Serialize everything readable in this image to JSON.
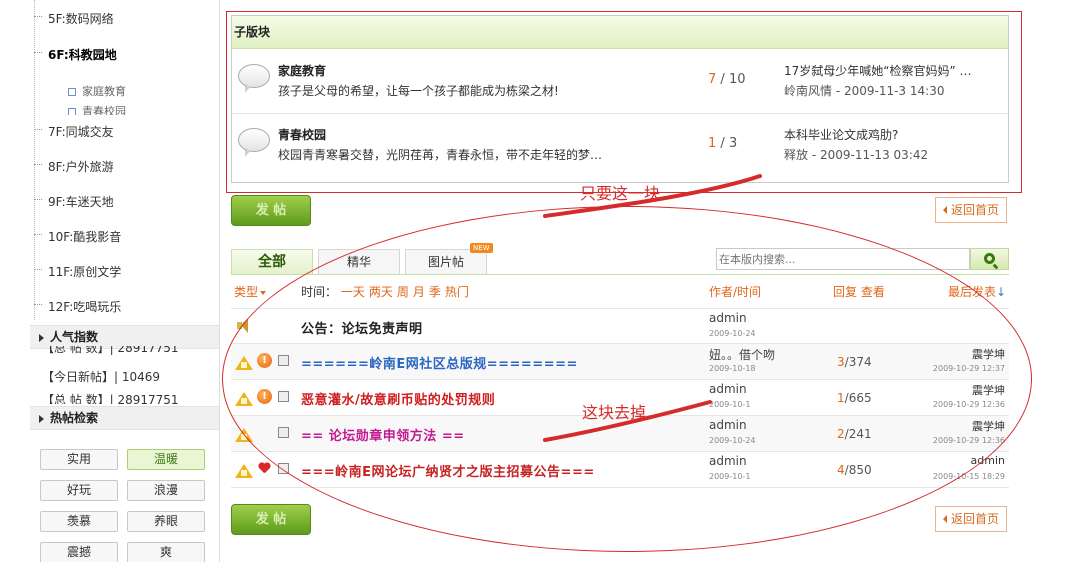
{
  "sidebar": {
    "forums": [
      {
        "label": "5F:数码网络"
      },
      {
        "label": "6F:科教园地"
      },
      {
        "label": "7F:同城交友"
      },
      {
        "label": "8F:户外旅游"
      },
      {
        "label": "9F:车迷天地"
      },
      {
        "label": "10F:酷我影音"
      },
      {
        "label": "11F:原创文学"
      },
      {
        "label": "12F:吃喝玩乐"
      }
    ],
    "subforums": [
      {
        "label": "家庭教育"
      },
      {
        "label": "青春校园"
      }
    ],
    "popularity": {
      "title": "人气指数",
      "rows": [
        {
          "label": "【总 帖 数】| 28917751"
        },
        {
          "label": "【今日新帖】| 10469"
        },
        {
          "label": "【总 帖 数】| 28917751"
        }
      ]
    },
    "hot_search": {
      "title": "热帖检索",
      "tags": [
        "实用",
        "温暖",
        "好玩",
        "浪漫",
        "羡慕",
        "养眼",
        "震撼",
        "爽"
      ],
      "active_tag": "温暖"
    }
  },
  "subforum_box": {
    "title": "子版块",
    "rows": [
      {
        "name": "家庭教育",
        "desc": "孩子是父母的希望，让每一个孩子都能成为栋梁之材!",
        "threads": "7",
        "sep": " / ",
        "posts": "10",
        "last_title": "17岁弑母少年喊她“检察官妈妈” …",
        "last_meta": "岭南风情 - 2009-11-3 14:30"
      },
      {
        "name": "青春校园",
        "desc": "校园青青寒暑交替，光阴荏苒，青春永恒，带不走年轻的梦…",
        "threads": "1",
        "sep": " / ",
        "posts": "3",
        "last_title": "本科毕业论文成鸡肋?",
        "last_meta": "释放 - 2009-11-13 03:42"
      }
    ]
  },
  "buttons": {
    "post": "发 帖",
    "home": "返回首页"
  },
  "tabs": {
    "items": [
      "全部",
      "精华",
      "图片帖"
    ],
    "new_badge": "NEW"
  },
  "search": {
    "placeholder": "在本版内搜索..."
  },
  "list_header": {
    "type": "类型",
    "time_label": "时间：",
    "time_filters": [
      "一天",
      "两天",
      "周",
      "月",
      "季",
      "热门"
    ],
    "author": "作者/时间",
    "stats": "回复 查看",
    "last": "最后发表"
  },
  "threads": [
    {
      "title": "公告：论坛免责声明",
      "author": "admin",
      "date": "2009-10-24",
      "replies": "",
      "views": "",
      "last_user": "",
      "last_time": ""
    },
    {
      "title": "======岭南E网社区总版规========",
      "author": "妞。。借个吻",
      "date": "2009-10-18",
      "replies": "3",
      "views": "374",
      "last_user": "震学坤",
      "last_time": "2009-10-29 12:37"
    },
    {
      "title": "恶意灌水/故意刷币贴的处罚规则",
      "author": "admin",
      "date": "2009-10-1",
      "replies": "1",
      "views": "665",
      "last_user": "震学坤",
      "last_time": "2009-10-29 12:36"
    },
    {
      "title": "== 论坛勋章申领方法 ==",
      "author": "admin",
      "date": "2009-10-24",
      "replies": "2",
      "views": "241",
      "last_user": "震学坤",
      "last_time": "2009-10-29 12:36"
    },
    {
      "title": "===岭南E网论坛广纳贤才之版主招募公告===",
      "author": "admin",
      "date": "2009-10-1",
      "replies": "4",
      "views": "850",
      "last_user": "admin",
      "last_time": "2009-10-15 18:29"
    }
  ],
  "annotations": {
    "keep": "只要这一块",
    "remove": "这块去掉"
  },
  "colors": {
    "accent_green": "#5e9b1c",
    "accent_orange": "#e0661a",
    "annotation_red": "#d52b2b"
  }
}
